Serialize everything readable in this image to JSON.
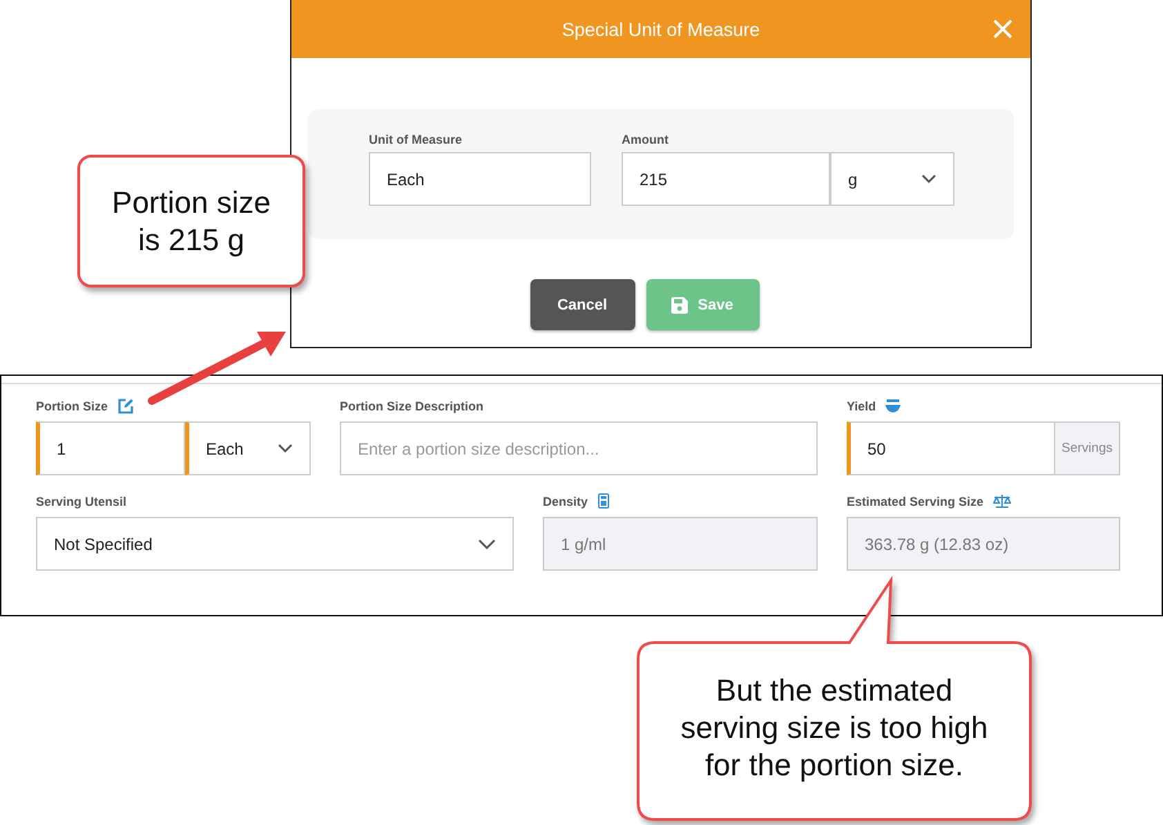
{
  "dialog": {
    "title": "Special Unit of Measure",
    "unit_of_measure": {
      "label": "Unit of Measure",
      "value": "Each"
    },
    "amount": {
      "label": "Amount",
      "value": "215",
      "unit": "g"
    },
    "buttons": [
      {
        "label": "Cancel",
        "kind": "cancel"
      },
      {
        "label": "Save",
        "kind": "save"
      }
    ]
  },
  "form": {
    "portion_size": {
      "label": "Portion Size",
      "value": "1",
      "unit": "Each",
      "required": true
    },
    "portion_size_description": {
      "label": "Portion Size Description",
      "placeholder": "Enter a portion size description..."
    },
    "yield": {
      "label": "Yield",
      "value": "50",
      "addon": "Servings",
      "required": true
    },
    "serving_utensil": {
      "label": "Serving Utensil",
      "value": "Not Specified"
    },
    "density": {
      "label": "Density",
      "value": "1 g/ml",
      "disabled": true
    },
    "estimated_serving_size": {
      "label": "Estimated Serving Size",
      "value": "363.78 g (12.83 oz)",
      "disabled": true
    }
  },
  "callouts": [
    {
      "text": "Portion size\nis 215 g"
    },
    {
      "text": "But the estimated\nserving size is too high\nfor the portion size."
    }
  ]
}
